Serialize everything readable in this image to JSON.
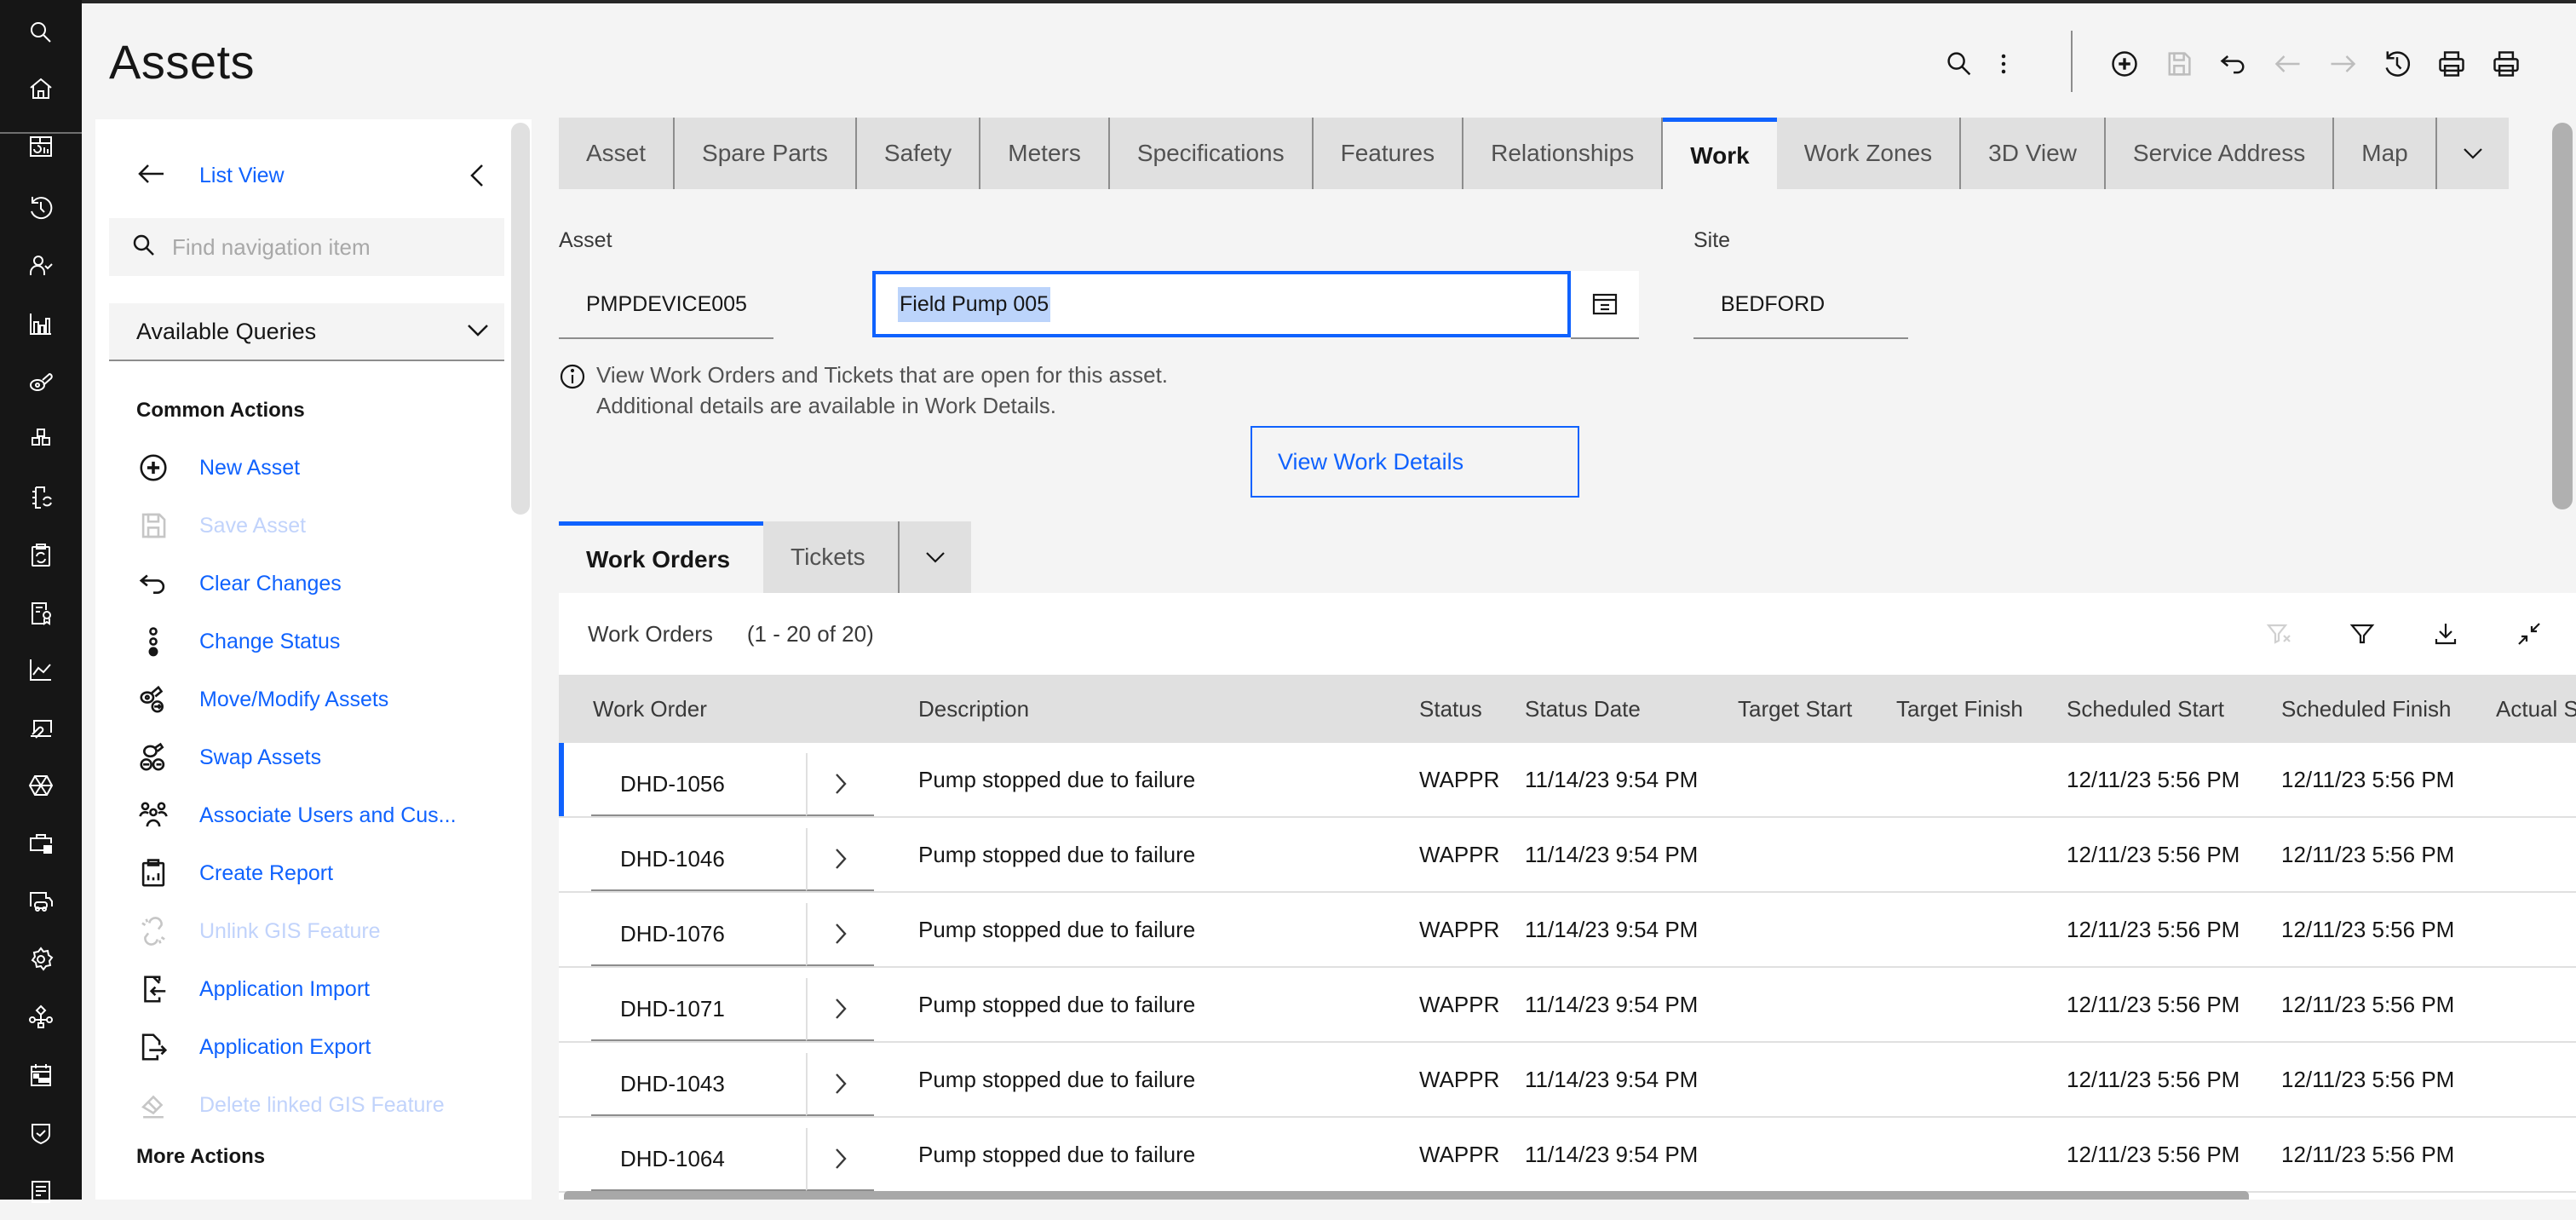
{
  "app": {
    "title": "Assets"
  },
  "rail": {
    "items": [
      {
        "icon": "search-icon"
      },
      {
        "icon": "home-icon"
      },
      {
        "icon": "dashboard-icon"
      },
      {
        "icon": "history-icon"
      },
      {
        "icon": "user-check-icon"
      },
      {
        "icon": "bar-chart-icon"
      },
      {
        "icon": "asset-icon"
      },
      {
        "icon": "cubes-icon"
      },
      {
        "icon": "notebook-sync-icon"
      },
      {
        "icon": "clipboard-sync-icon"
      },
      {
        "icon": "certificate-icon"
      },
      {
        "icon": "line-chart-icon"
      },
      {
        "icon": "laptop-wrench-icon"
      },
      {
        "icon": "hexagon-icon"
      },
      {
        "icon": "toolbox-icon"
      },
      {
        "icon": "delivery-truck-icon"
      },
      {
        "icon": "settings-icon"
      },
      {
        "icon": "workflow-icon"
      },
      {
        "icon": "calendar-icon"
      },
      {
        "icon": "security-shield-icon"
      },
      {
        "icon": "report-icon"
      }
    ]
  },
  "header": {
    "actions": [
      {
        "name": "search-icon",
        "disabled": false
      },
      {
        "name": "overflow-menu-icon",
        "disabled": false
      },
      {
        "name": "new-record-icon",
        "disabled": false
      },
      {
        "name": "save-icon",
        "disabled": true
      },
      {
        "name": "undo-icon",
        "disabled": false
      },
      {
        "name": "previous-record-icon",
        "disabled": true
      },
      {
        "name": "next-record-icon",
        "disabled": true
      },
      {
        "name": "history-icon",
        "disabled": false
      },
      {
        "name": "print-icon",
        "disabled": false
      },
      {
        "name": "print-alt-icon",
        "disabled": false
      }
    ]
  },
  "nav": {
    "list_view_label": "List View",
    "search_placeholder": "Find navigation item",
    "search_value": "",
    "queries_label": "Available Queries",
    "common_actions_title": "Common Actions",
    "more_actions_title": "More Actions",
    "common_actions": [
      {
        "label": "New Asset",
        "icon": "add-circle-icon",
        "disabled": false
      },
      {
        "label": "Save Asset",
        "icon": "save-icon",
        "disabled": true
      },
      {
        "label": "Clear Changes",
        "icon": "undo-icon",
        "disabled": false
      },
      {
        "label": "Change Status",
        "icon": "status-icon",
        "disabled": false
      },
      {
        "label": "Move/Modify Assets",
        "icon": "move-asset-icon",
        "disabled": false
      },
      {
        "label": "Swap Assets",
        "icon": "swap-asset-icon",
        "disabled": false
      },
      {
        "label": "Associate Users and Cus...",
        "icon": "user-group-icon",
        "disabled": false
      },
      {
        "label": "Create Report",
        "icon": "report-clipboard-icon",
        "disabled": false
      },
      {
        "label": "Unlink GIS Feature",
        "icon": "unlink-icon",
        "disabled": true
      },
      {
        "label": "Application Import",
        "icon": "document-import-icon",
        "disabled": false
      },
      {
        "label": "Application Export",
        "icon": "document-export-icon",
        "disabled": false
      },
      {
        "label": "Delete linked GIS Feature",
        "icon": "erase-icon",
        "disabled": true
      }
    ]
  },
  "tabs": [
    {
      "label": "Asset",
      "active": false
    },
    {
      "label": "Spare Parts",
      "active": false
    },
    {
      "label": "Safety",
      "active": false
    },
    {
      "label": "Meters",
      "active": false
    },
    {
      "label": "Specifications",
      "active": false
    },
    {
      "label": "Features",
      "active": false
    },
    {
      "label": "Relationships",
      "active": false
    },
    {
      "label": "Work",
      "active": true
    },
    {
      "label": "Work Zones",
      "active": false
    },
    {
      "label": "3D View",
      "active": false
    },
    {
      "label": "Service Address",
      "active": false
    },
    {
      "label": "Map",
      "active": false
    }
  ],
  "work": {
    "asset_label": "Asset",
    "asset_value": "PMPDEVICE005",
    "description_value": "Field Pump 005",
    "site_label": "Site",
    "site_value": "BEDFORD",
    "info_line1": "View Work Orders and Tickets that are open for this asset.",
    "info_line2": "Additional details are available in Work Details.",
    "view_details_button": "View Work Details",
    "subtabs": [
      {
        "label": "Work Orders",
        "active": true
      },
      {
        "label": "Tickets",
        "active": false
      }
    ]
  },
  "table": {
    "title": "Work Orders",
    "count": "(1 - 20 of 20)",
    "toolbar_icons": [
      {
        "name": "clear-filter-icon",
        "disabled": true
      },
      {
        "name": "filter-icon",
        "disabled": false
      },
      {
        "name": "download-icon",
        "disabled": false
      },
      {
        "name": "minimize-icon",
        "disabled": false
      }
    ],
    "columns": [
      "Work Order",
      "Description",
      "Status",
      "Status Date",
      "Target Start",
      "Target Finish",
      "Scheduled Start",
      "Scheduled Finish",
      "Actual S"
    ],
    "rows": [
      {
        "work_order": "DHD-1056",
        "description": "Pump stopped due to failure",
        "status": "WAPPR",
        "status_date": "11/14/23 9:54 PM",
        "target_start": "",
        "target_finish": "",
        "scheduled_start": "12/11/23 5:56 PM",
        "scheduled_finish": "12/11/23 5:56 PM",
        "selected": true
      },
      {
        "work_order": "DHD-1046",
        "description": "Pump stopped due to failure",
        "status": "WAPPR",
        "status_date": "11/14/23 9:54 PM",
        "target_start": "",
        "target_finish": "",
        "scheduled_start": "12/11/23 5:56 PM",
        "scheduled_finish": "12/11/23 5:56 PM",
        "selected": false
      },
      {
        "work_order": "DHD-1076",
        "description": "Pump stopped due to failure",
        "status": "WAPPR",
        "status_date": "11/14/23 9:54 PM",
        "target_start": "",
        "target_finish": "",
        "scheduled_start": "12/11/23 5:56 PM",
        "scheduled_finish": "12/11/23 5:56 PM",
        "selected": false
      },
      {
        "work_order": "DHD-1071",
        "description": "Pump stopped due to failure",
        "status": "WAPPR",
        "status_date": "11/14/23 9:54 PM",
        "target_start": "",
        "target_finish": "",
        "scheduled_start": "12/11/23 5:56 PM",
        "scheduled_finish": "12/11/23 5:56 PM",
        "selected": false
      },
      {
        "work_order": "DHD-1043",
        "description": "Pump stopped due to failure",
        "status": "WAPPR",
        "status_date": "11/14/23 9:54 PM",
        "target_start": "",
        "target_finish": "",
        "scheduled_start": "12/11/23 5:56 PM",
        "scheduled_finish": "12/11/23 5:56 PM",
        "selected": false
      },
      {
        "work_order": "DHD-1064",
        "description": "Pump stopped due to failure",
        "status": "WAPPR",
        "status_date": "11/14/23 9:54 PM",
        "target_start": "",
        "target_finish": "",
        "scheduled_start": "12/11/23 5:56 PM",
        "scheduled_finish": "12/11/23 5:56 PM",
        "selected": false
      }
    ]
  },
  "colors": {
    "accent": "#0f62fe",
    "rail_bg": "#161616",
    "page_bg": "#f4f4f4",
    "tab_bg": "#e0e0e0",
    "selection": "#bcd4fb"
  }
}
